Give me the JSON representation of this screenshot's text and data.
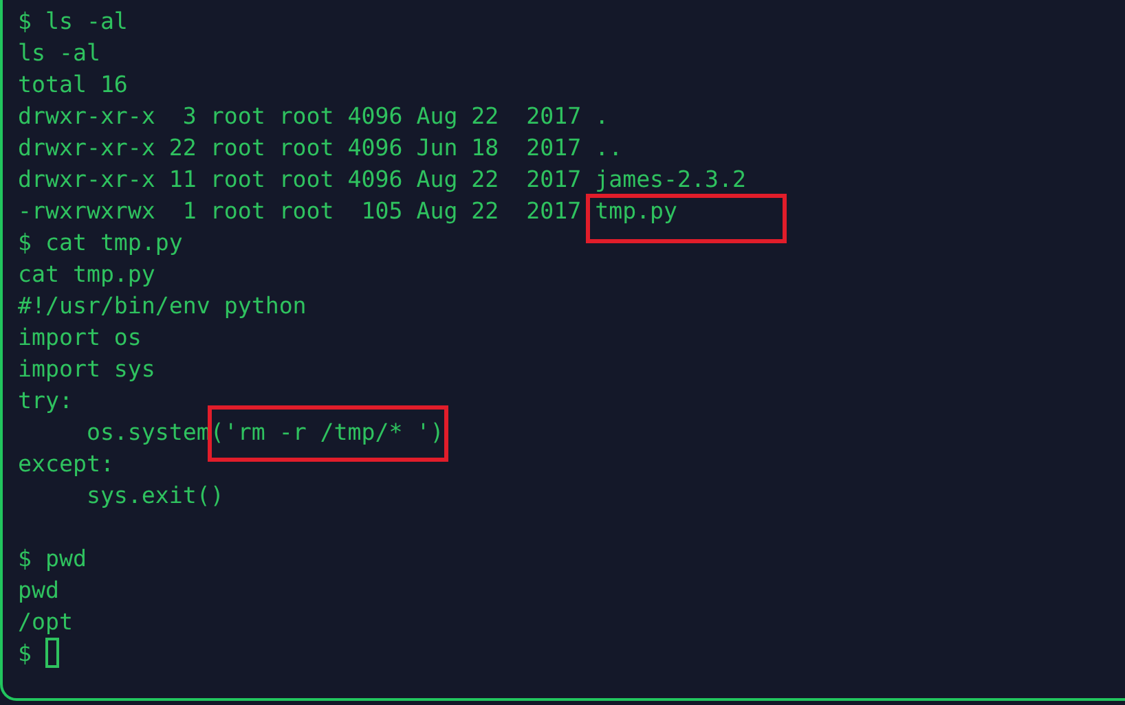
{
  "terminal": {
    "lines": [
      {
        "kind": "text",
        "text": "$ ls -al",
        "cursor": false
      },
      {
        "kind": "text",
        "text": "ls -al",
        "cursor": false
      },
      {
        "kind": "text",
        "text": "total 16",
        "cursor": false
      },
      {
        "kind": "text",
        "text": "drwxr-xr-x  3 root root 4096 Aug 22  2017 .",
        "cursor": false
      },
      {
        "kind": "text",
        "text": "drwxr-xr-x 22 root root 4096 Jun 18  2017 ..",
        "cursor": false
      },
      {
        "kind": "text",
        "text": "drwxr-xr-x 11 root root 4096 Aug 22  2017 james-2.3.2",
        "cursor": false
      },
      {
        "kind": "text",
        "text": "-rwxrwxrwx  1 root root  105 Aug 22  2017 ",
        "marked": "tmp.py",
        "cursor": false
      },
      {
        "kind": "text",
        "text": "$ cat tmp.py",
        "cursor": false
      },
      {
        "kind": "text",
        "text": "cat tmp.py",
        "cursor": false
      },
      {
        "kind": "text",
        "text": "#!/usr/bin/env python",
        "cursor": false
      },
      {
        "kind": "text",
        "text": "import os",
        "cursor": false
      },
      {
        "kind": "text",
        "text": "import sys",
        "cursor": false
      },
      {
        "kind": "text",
        "text": "try:",
        "cursor": false
      },
      {
        "kind": "text",
        "text": "     os.system",
        "marked": "('rm -r /tmp/* ')",
        "cursor": false
      },
      {
        "kind": "text",
        "text": "except:",
        "cursor": false
      },
      {
        "kind": "text",
        "text": "     sys.exit()",
        "cursor": false
      },
      {
        "kind": "blank"
      },
      {
        "kind": "text",
        "text": "$ pwd",
        "cursor": false
      },
      {
        "kind": "text",
        "text": "pwd",
        "cursor": false
      },
      {
        "kind": "text",
        "text": "/opt",
        "cursor": false
      },
      {
        "kind": "text",
        "text": "$ ",
        "cursor": true
      }
    ]
  }
}
